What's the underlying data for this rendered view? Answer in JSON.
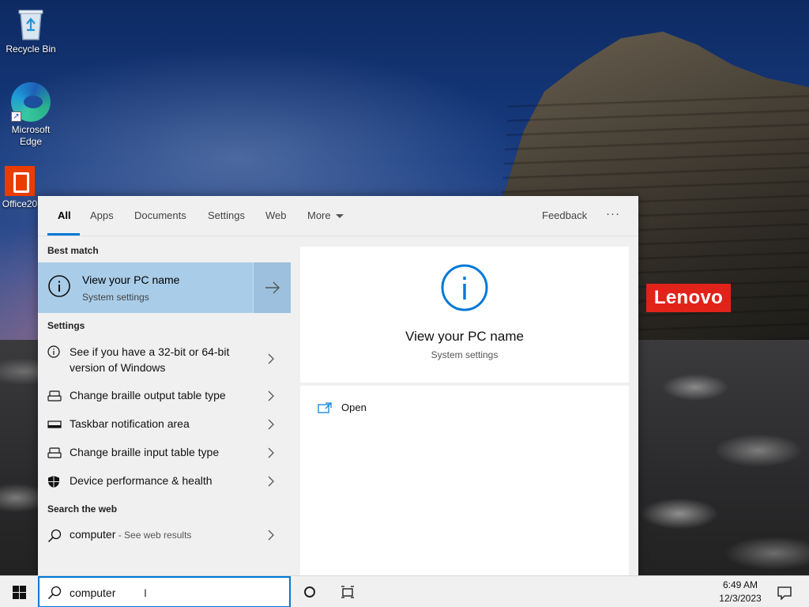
{
  "desktop": {
    "icons": [
      {
        "label": "Recycle Bin",
        "icon": "recycle-bin-icon"
      },
      {
        "label": "Microsoft Edge",
        "icon": "edge-icon"
      },
      {
        "label": "Office20",
        "icon": "office-icon"
      }
    ],
    "brand_badge": "Lenovo"
  },
  "search_panel": {
    "tabs": [
      {
        "label": "All",
        "active": true
      },
      {
        "label": "Apps"
      },
      {
        "label": "Documents"
      },
      {
        "label": "Settings"
      },
      {
        "label": "Web"
      },
      {
        "label": "More"
      }
    ],
    "feedback_label": "Feedback",
    "more_options_label": "···",
    "best_match": {
      "header": "Best match",
      "title": "View your PC name",
      "subtitle": "System settings",
      "icon": "info-icon"
    },
    "settings_header": "Settings",
    "settings_results": [
      {
        "label": "See if you have a 32-bit or 64-bit version of Windows",
        "icon": "info-icon"
      },
      {
        "label": "Change braille output table type",
        "icon": "braille-icon"
      },
      {
        "label": "Taskbar notification area",
        "icon": "taskbar-icon"
      },
      {
        "label": "Change braille input table type",
        "icon": "braille-icon"
      },
      {
        "label": "Device performance & health",
        "icon": "shield-icon"
      }
    ],
    "web_header": "Search the web",
    "web_result": {
      "query": "computer",
      "suffix": " - See web results",
      "icon": "search-icon"
    },
    "preview": {
      "title": "View your PC name",
      "subtitle": "System settings",
      "icon": "info-icon",
      "action_open": "Open"
    }
  },
  "taskbar": {
    "search_value": "computer",
    "time": "6:49 AM",
    "date": "12/3/2023"
  },
  "colors": {
    "accent": "#0078d7",
    "best_match_bg": "#a9cde9",
    "brand_red": "#e2231a"
  }
}
